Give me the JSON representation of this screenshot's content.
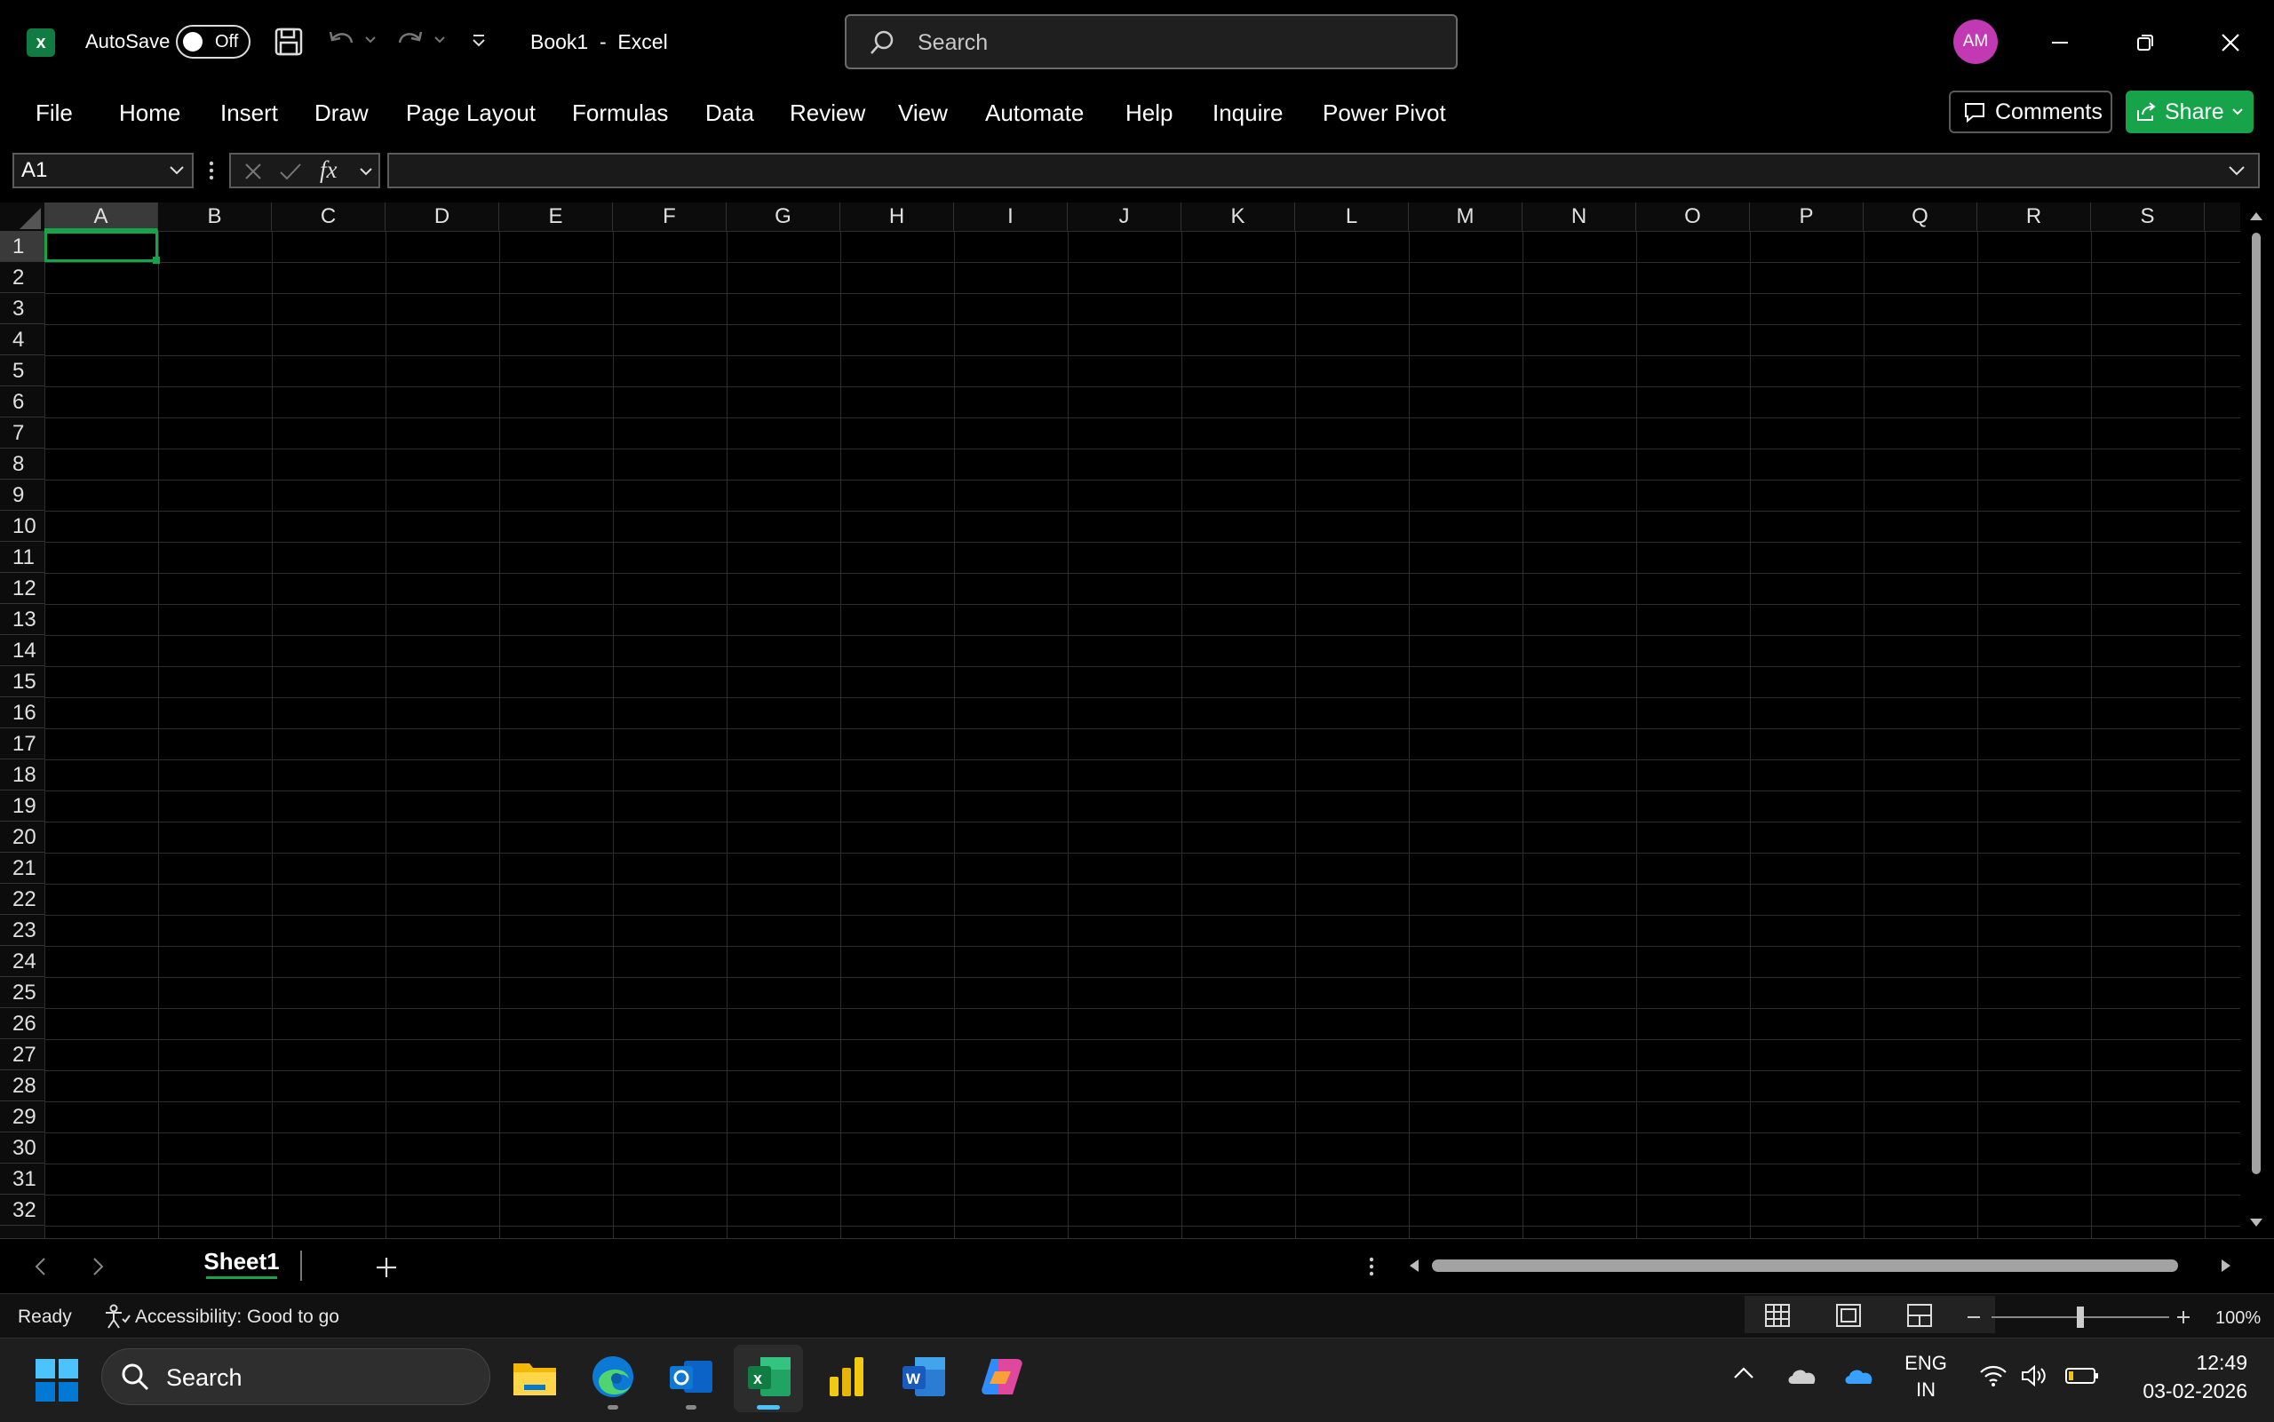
{
  "titlebar": {
    "autosave_label": "AutoSave",
    "autosave_state": "Off",
    "document_title": "Book1  -  Excel",
    "search_placeholder": "Search",
    "avatar_initials": "AM"
  },
  "menu": {
    "items": [
      "File",
      "Home",
      "Insert",
      "Draw",
      "Page Layout",
      "Formulas",
      "Data",
      "Review",
      "View",
      "Automate",
      "Help",
      "Inquire",
      "Power Pivot"
    ],
    "comments_label": "Comments",
    "share_label": "Share"
  },
  "formula_bar": {
    "name_box": "A1",
    "fx_label": "fx",
    "formula_value": ""
  },
  "grid": {
    "columns": [
      "A",
      "B",
      "C",
      "D",
      "E",
      "F",
      "G",
      "H",
      "I",
      "J",
      "K",
      "L",
      "M",
      "N",
      "O",
      "P",
      "Q",
      "R",
      "S"
    ],
    "rows": [
      "1",
      "2",
      "3",
      "4",
      "5",
      "6",
      "7",
      "8",
      "9",
      "10",
      "11",
      "12",
      "13",
      "14",
      "15",
      "16",
      "17",
      "18",
      "19",
      "20",
      "21",
      "22",
      "23",
      "24",
      "25",
      "26",
      "27",
      "28",
      "29",
      "30",
      "31",
      "32"
    ],
    "active_cell": "A1"
  },
  "sheets": {
    "tabs": [
      "Sheet1"
    ],
    "active": "Sheet1"
  },
  "status": {
    "mode": "Ready",
    "accessibility": "Accessibility: Good to go",
    "zoom": "100%",
    "zoom_level": 1.0
  },
  "taskbar": {
    "search_label": "Search",
    "language_line1": "ENG",
    "language_line2": "IN",
    "time": "12:49",
    "date": "03-02-2026"
  },
  "colors": {
    "accent": "#16a34a",
    "excel_green": "#107c41",
    "avatar": "#c239b3",
    "background": "#000000"
  }
}
